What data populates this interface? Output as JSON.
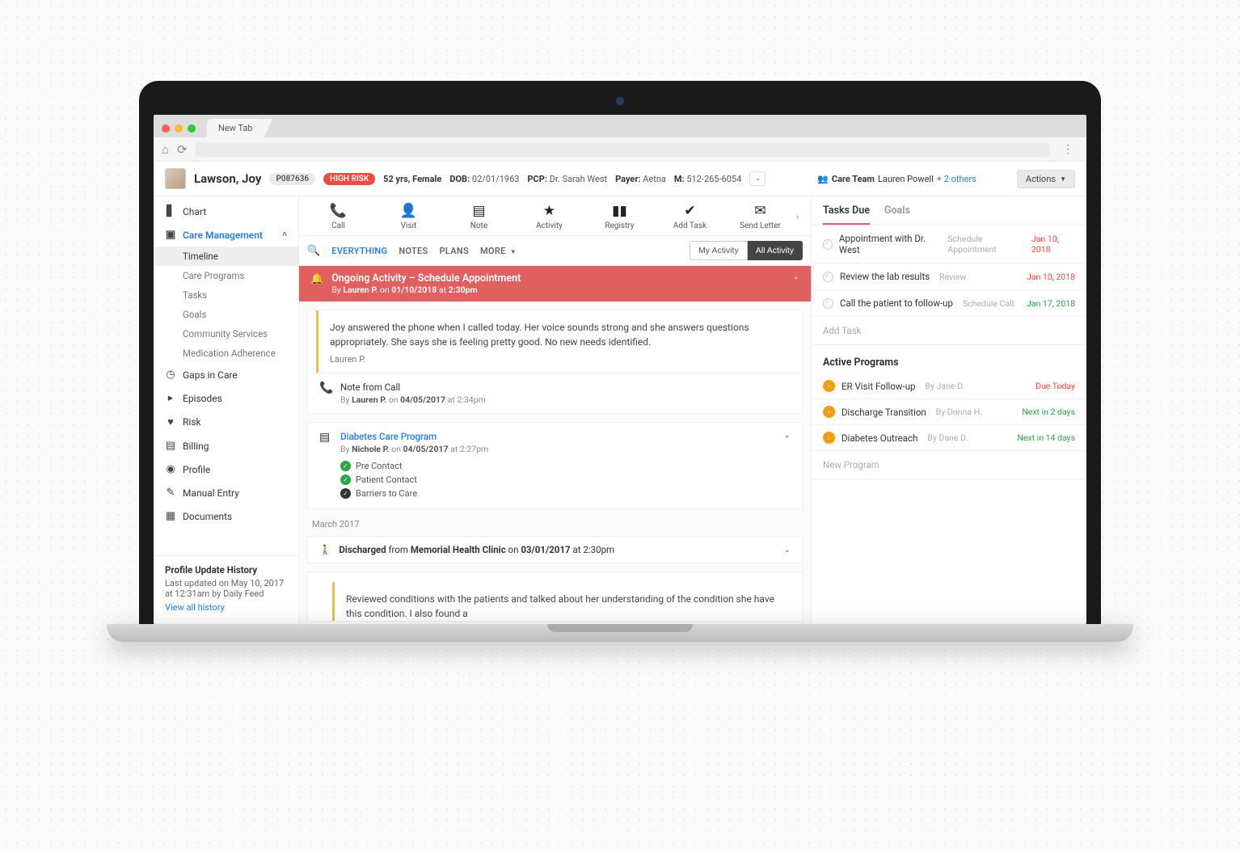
{
  "browser": {
    "tab_label": "New Tab"
  },
  "patient": {
    "name": "Lawson, Joy",
    "id": "P087636",
    "risk_label": "HIGH RISK",
    "age_gender": "52 yrs, Female",
    "dob_label": "DOB:",
    "dob": "02/01/1963",
    "pcp_label": "PCP:",
    "pcp": "Dr. Sarah West",
    "payer_label": "Payer:",
    "payer": "Aetna",
    "phone_label": "M:",
    "phone": "512-265-6054",
    "care_team_label": "Care Team",
    "care_team_primary": "Lauren Powell",
    "care_team_others": "+ 2 others",
    "actions_label": "Actions"
  },
  "sidebar": {
    "items": [
      {
        "label": "Chart"
      },
      {
        "label": "Care Management"
      },
      {
        "label": "Gaps in Care"
      },
      {
        "label": "Episodes"
      },
      {
        "label": "Risk"
      },
      {
        "label": "Billing"
      },
      {
        "label": "Profile"
      },
      {
        "label": "Manual Entry"
      },
      {
        "label": "Documents"
      }
    ],
    "care_sub": [
      {
        "label": "Timeline"
      },
      {
        "label": "Care Programs"
      },
      {
        "label": "Tasks"
      },
      {
        "label": "Goals"
      },
      {
        "label": "Community Services"
      },
      {
        "label": "Medication Adherence"
      }
    ],
    "history": {
      "title": "Profile Update History",
      "text": "Last updated on May 10, 2017 at 12:31am by Daily Feed",
      "link": "View all history"
    }
  },
  "actions_row": [
    {
      "label": "Call"
    },
    {
      "label": "Visit"
    },
    {
      "label": "Note"
    },
    {
      "label": "Activity"
    },
    {
      "label": "Registry"
    },
    {
      "label": "Add Task"
    },
    {
      "label": "Send Letter"
    }
  ],
  "filters": {
    "everything": "EVERYTHING",
    "notes": "NOTES",
    "plans": "PLANS",
    "more": "MORE",
    "my_activity": "My Activity",
    "all_activity": "All Activity"
  },
  "alert": {
    "title": "Ongoing Activity – Schedule Appointment",
    "by_prefix": "By ",
    "author": "Lauren P.",
    "on": " on ",
    "date": "01/10/2018",
    "at": " at ",
    "time": "2:30pm"
  },
  "feed": {
    "note1_body": "Joy answered the phone when I called today. Her voice sounds strong and she answers questions appropriately. She says she is feeling pretty good. No new needs identified.",
    "note1_author": "Lauren P.",
    "call_title": "Note from Call",
    "call_by_prefix": "By ",
    "call_author": "Lauren P.",
    "call_on": " on ",
    "call_date": "04/05/2017",
    "call_at": " at ",
    "call_time": "2:34pm",
    "program_title": "Diabetes Care Program",
    "program_by_prefix": "By ",
    "program_author": "Nichole P.",
    "program_on": " on ",
    "program_date": "04/05/2017",
    "program_at": " at ",
    "program_time": "2:27pm",
    "steps": [
      {
        "label": "Pre Contact"
      },
      {
        "label": "Patient Contact"
      },
      {
        "label": "Barriers to Care"
      }
    ],
    "month_header": "March 2017",
    "discharge_prefix": "Discharged ",
    "discharge_from": "from ",
    "discharge_place": "Memorial Health Clinic",
    "discharge_on": " on ",
    "discharge_date": "03/01/2017",
    "discharge_at": " at ",
    "discharge_time": "2:30pm",
    "note2_body": "Reviewed conditions with the patients and talked about her understanding of the condition she have this condition. I also found a"
  },
  "right": {
    "tab_tasks": "Tasks Due",
    "tab_goals": "Goals",
    "tasks": [
      {
        "title": "Appointment with Dr. West",
        "sub": "Schedule Appointment",
        "date": "Jan 10, 2018",
        "cls": "red"
      },
      {
        "title": "Review the lab results",
        "sub": "Review",
        "date": "Jan 10, 2018",
        "cls": "red"
      },
      {
        "title": "Call the patient to follow-up",
        "sub": "Schedule Call",
        "date": "Jan 17, 2018",
        "cls": "green"
      }
    ],
    "add_task": "Add Task",
    "programs_title": "Active Programs",
    "programs": [
      {
        "title": "ER Visit Follow-up",
        "by": "By Jane D.",
        "due": "Due Today",
        "cls": "red"
      },
      {
        "title": "Discharge Transition",
        "by": "By Donna H.",
        "due": "Next in 2 days",
        "cls": "green"
      },
      {
        "title": "Diabetes Outreach",
        "by": "By Dane D.",
        "due": "Next in 14 days",
        "cls": "green"
      }
    ],
    "new_program": "New Program"
  }
}
